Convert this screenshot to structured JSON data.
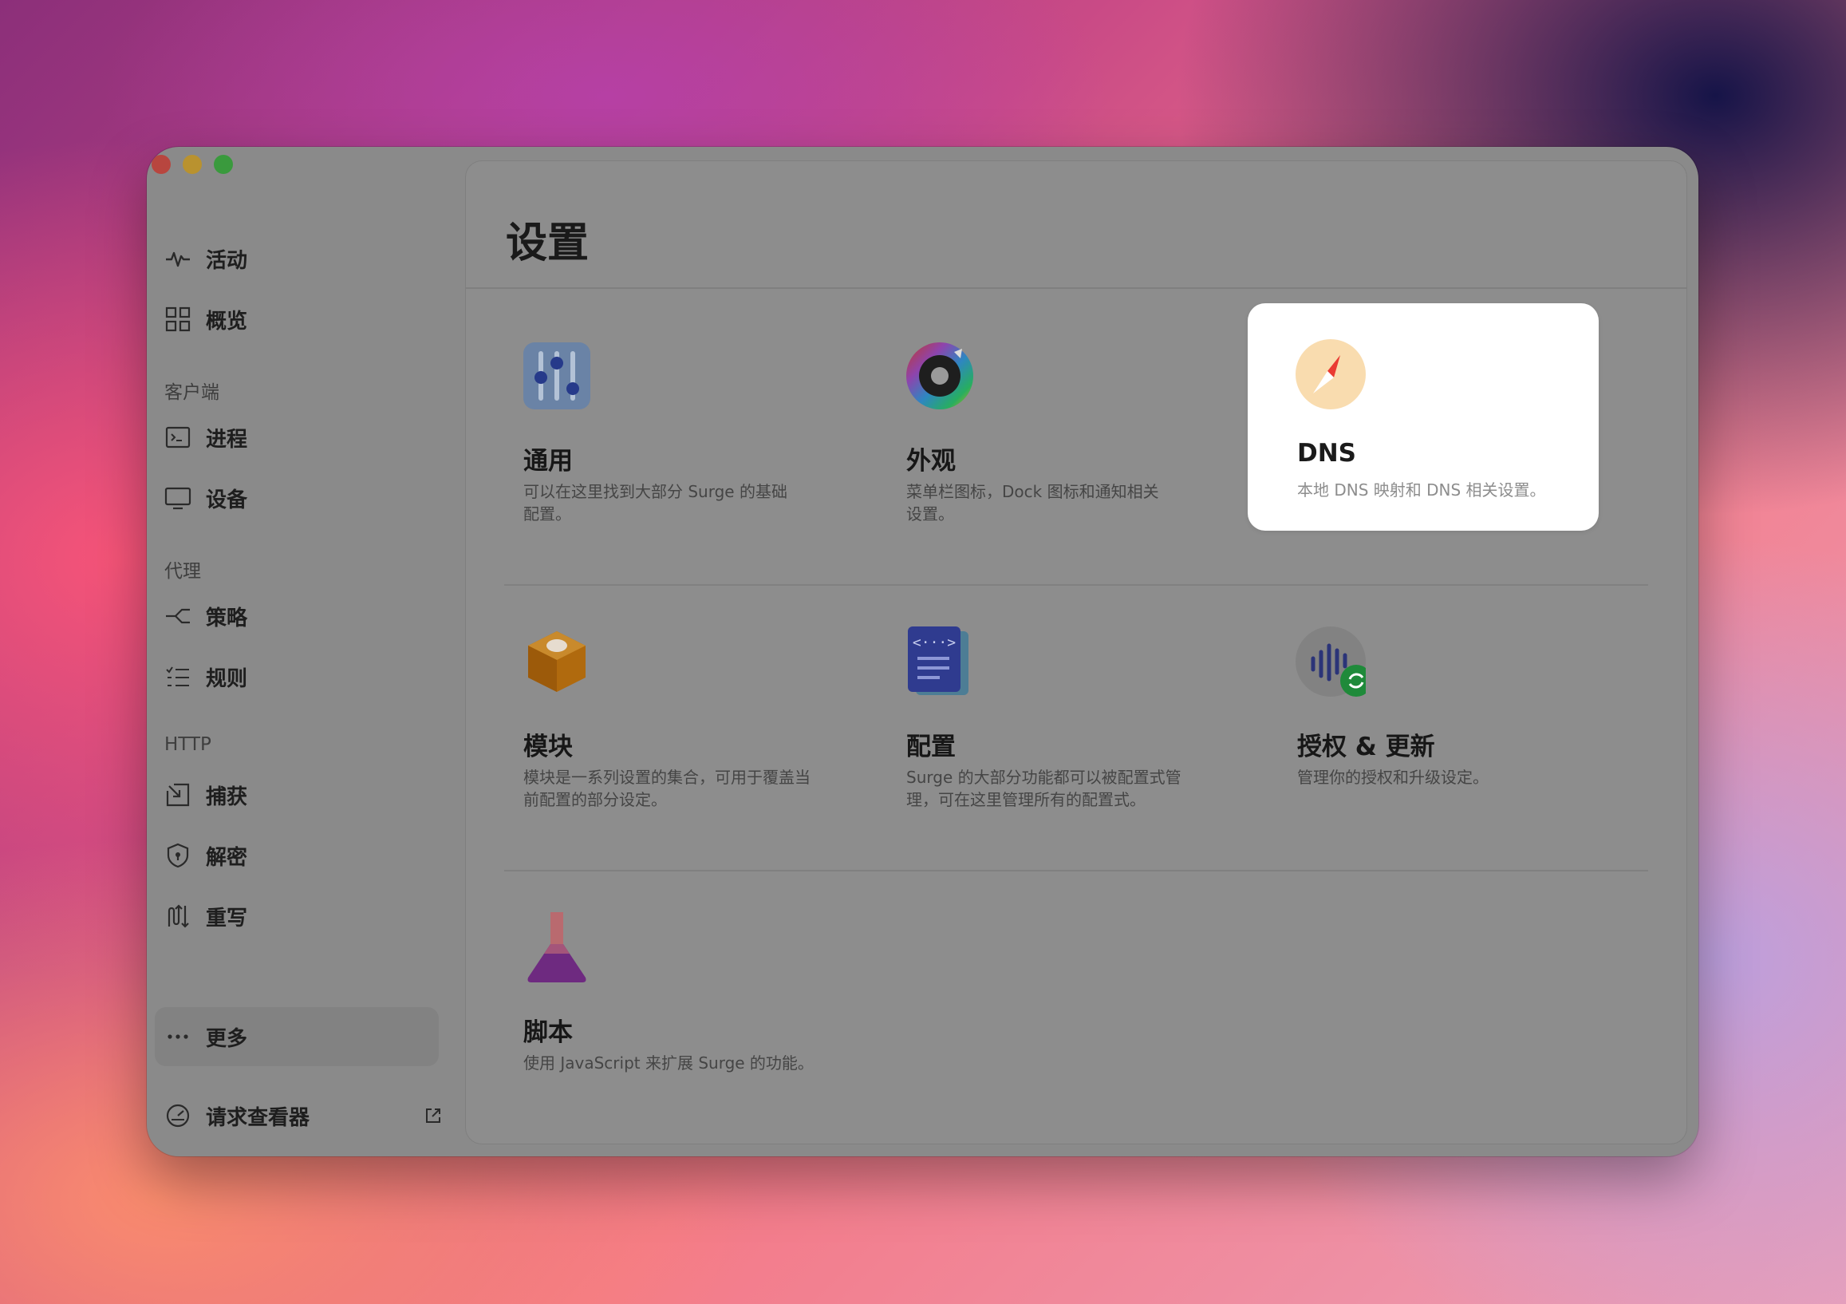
{
  "window": {
    "traffic_lights": [
      "close",
      "minimize",
      "zoom"
    ]
  },
  "sidebar": {
    "items_top": [
      {
        "label": "活动",
        "icon": "activity-icon"
      },
      {
        "label": "概览",
        "icon": "grid-icon"
      }
    ],
    "sections": [
      {
        "title": "客户端",
        "items": [
          {
            "label": "进程",
            "icon": "terminal-icon"
          },
          {
            "label": "设备",
            "icon": "monitor-icon"
          }
        ]
      },
      {
        "title": "代理",
        "items": [
          {
            "label": "策略",
            "icon": "branch-icon"
          },
          {
            "label": "规则",
            "icon": "checklist-icon"
          }
        ]
      },
      {
        "title": "HTTP",
        "items": [
          {
            "label": "捕获",
            "icon": "capture-icon"
          },
          {
            "label": "解密",
            "icon": "shield-icon"
          },
          {
            "label": "重写",
            "icon": "rewrite-icon"
          }
        ]
      }
    ],
    "more": {
      "label": "更多",
      "icon": "ellipsis-icon"
    },
    "request_viewer": {
      "label": "请求查看器",
      "icon": "gauge-icon"
    }
  },
  "main": {
    "title": "设置",
    "cards": [
      {
        "title": "通用",
        "desc_line1": "可以在这里找到大部分 Surge 的基础",
        "desc_line2": "配置。",
        "icon": "sliders-icon"
      },
      {
        "title": "外观",
        "desc_line1": "菜单栏图标，Dock 图标和通知相关",
        "desc_line2": "设置。",
        "icon": "color-wheel-icon"
      },
      {
        "title": "DNS",
        "desc_line1": "本地 DNS 映射和 DNS 相关设置。",
        "desc_line2": "",
        "icon": "compass-icon"
      },
      {
        "title": "模块",
        "desc_line1": "模块是一系列设置的集合，可用于覆盖当",
        "desc_line2": "前配置的部分设定。",
        "icon": "module-box-icon"
      },
      {
        "title": "配置",
        "desc_line1": "Surge 的大部分功能都可以被配置式管",
        "desc_line2": "理，可在这里管理所有的配置式。",
        "icon": "config-document-icon"
      },
      {
        "title": "授权 & 更新",
        "desc_line1": "管理你的授权和升级设定。",
        "desc_line2": "",
        "icon": "license-update-icon"
      },
      {
        "title": "脚本",
        "desc_line1": "使用 JavaScript 来扩展 Surge 的功能。",
        "desc_line2": "",
        "icon": "flask-icon"
      }
    ],
    "selected_card": "DNS"
  },
  "colors": {
    "selected_card_bg": "#ffffff",
    "dimmed_window_bg": "#8a8a8a"
  }
}
